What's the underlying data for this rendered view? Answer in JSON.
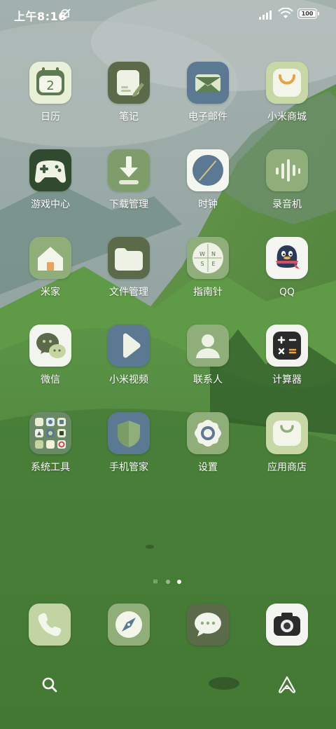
{
  "status_bar": {
    "time": "上午8:16",
    "battery": "100",
    "icons": [
      "bell-off-icon",
      "signal-icon",
      "wifi-icon",
      "battery-icon"
    ]
  },
  "apps": [
    {
      "label": "日历",
      "icon": "calendar-icon",
      "text": "2"
    },
    {
      "label": "笔记",
      "icon": "notes-icon"
    },
    {
      "label": "电子邮件",
      "icon": "mail-icon"
    },
    {
      "label": "小米商城",
      "icon": "mi-store-icon"
    },
    {
      "label": "游戏中心",
      "icon": "gamepad-icon"
    },
    {
      "label": "下载管理",
      "icon": "download-icon"
    },
    {
      "label": "时钟",
      "icon": "clock-icon"
    },
    {
      "label": "录音机",
      "icon": "recorder-icon"
    },
    {
      "label": "米家",
      "icon": "home-icon"
    },
    {
      "label": "文件管理",
      "icon": "folder-icon"
    },
    {
      "label": "指南针",
      "icon": "compass-dial-icon",
      "text": [
        "W",
        "N",
        "S",
        "E"
      ]
    },
    {
      "label": "QQ",
      "icon": "qq-penguin-icon"
    },
    {
      "label": "微信",
      "icon": "wechat-icon"
    },
    {
      "label": "小米视频",
      "icon": "video-play-icon"
    },
    {
      "label": "联系人",
      "icon": "contacts-icon"
    },
    {
      "label": "计算器",
      "icon": "calculator-icon"
    },
    {
      "label": "系统工具",
      "icon": "folder-grid-icon"
    },
    {
      "label": "手机管家",
      "icon": "shield-icon"
    },
    {
      "label": "设置",
      "icon": "settings-gear-icon"
    },
    {
      "label": "应用商店",
      "icon": "app-store-icon"
    }
  ],
  "page_indicator": {
    "pages": 3,
    "current": 3
  },
  "dock": [
    "phone-icon",
    "browser-compass-icon",
    "messages-icon",
    "camera-icon"
  ],
  "bottom_bar": [
    "search-icon",
    "assistant-icon"
  ],
  "colors": {
    "sage_light": "#c3d4a4",
    "sage": "#8fae7a",
    "olive": "#5b6b49",
    "slate_blue": "#5c7994"
  }
}
